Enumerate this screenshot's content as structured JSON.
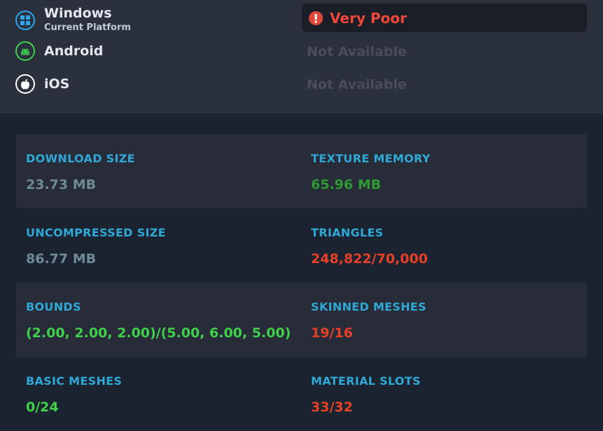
{
  "platforms": [
    {
      "name": "Windows",
      "subtitle": "Current Platform",
      "icon": "windows-icon",
      "status": "Very Poor",
      "status_icon": "warning-icon",
      "status_color": "#f0473b"
    },
    {
      "name": "Android",
      "subtitle": "",
      "icon": "android-icon",
      "status": "Not Available"
    },
    {
      "name": "iOS",
      "subtitle": "",
      "icon": "apple-icon",
      "status": "Not Available"
    }
  ],
  "stats": [
    {
      "label": "DOWNLOAD SIZE",
      "value": "23.73 MB",
      "color": "#6f8b95"
    },
    {
      "label": "TEXTURE MEMORY",
      "value": "65.96 MB",
      "color": "#2e9a34"
    },
    {
      "label": "UNCOMPRESSED SIZE",
      "value": "86.77 MB",
      "color": "#6f8b95"
    },
    {
      "label": "TRIANGLES",
      "value": "248,822/70,000",
      "color": "#e64126"
    },
    {
      "label": "BOUNDS",
      "value": "(2.00, 2.00, 2.00)/(5.00, 6.00, 5.00)",
      "color": "#3fd14a"
    },
    {
      "label": "SKINNED MESHES",
      "value": "19/16",
      "color": "#e64126"
    },
    {
      "label": "BASIC MESHES",
      "value": "0/24",
      "color": "#3fd14a"
    },
    {
      "label": "MATERIAL SLOTS",
      "value": "33/32",
      "color": "#e64126"
    }
  ]
}
